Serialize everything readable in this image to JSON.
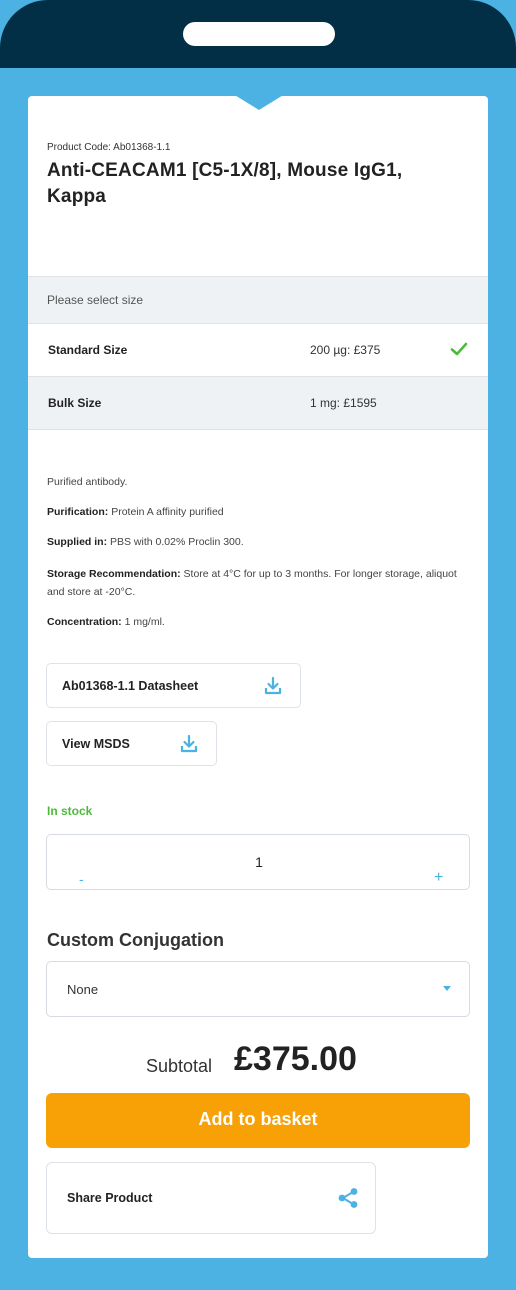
{
  "product": {
    "code_label": "Product Code: Ab01368-1.1",
    "title": "Anti-CEACAM1 [C5-1X/8], Mouse IgG1, Kappa"
  },
  "size_selector": {
    "header": "Please select size",
    "options": [
      {
        "name": "Standard Size",
        "price": "200 µg: £375",
        "selected": true
      },
      {
        "name": "Bulk Size",
        "price": "1 mg: £1595",
        "selected": false
      }
    ]
  },
  "specs": {
    "description": "Purified antibody.",
    "purification_label": "Purification:",
    "purification_value": "Protein A affinity purified",
    "supplied_label": "Supplied in:",
    "supplied_value": "PBS with 0.02% Proclin 300.",
    "storage_label": "Storage Recommendation:",
    "storage_value": "Store at 4°C for up to 3 months. For longer storage, aliquot and store at -20°C.",
    "concentration_label": "Concentration:",
    "concentration_value": "1 mg/ml."
  },
  "documents": {
    "datasheet_label": "Ab01368-1.1 Datasheet",
    "msds_label": "View MSDS"
  },
  "stock": {
    "status": "In stock",
    "color": "#4cbb3a"
  },
  "quantity": {
    "value": "1",
    "minus": "-",
    "plus": "+"
  },
  "conjugation": {
    "title": "Custom Conjugation",
    "selected": "None"
  },
  "subtotal": {
    "label": "Subtotal",
    "value": "£375.00"
  },
  "actions": {
    "add_to_basket": "Add to basket",
    "share_label": "Share Product"
  },
  "colors": {
    "accent": "#4bb2e3",
    "header": "#032f46",
    "button": "#f7a107"
  },
  "icons": {
    "selected": "check-icon",
    "download": "download-icon",
    "dropdown": "chevron-down-icon",
    "share": "share-icon"
  }
}
